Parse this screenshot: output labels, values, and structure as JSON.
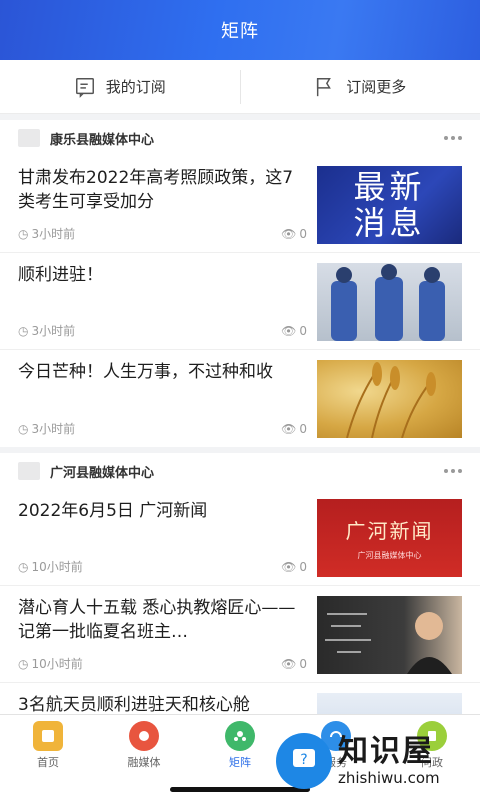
{
  "header": {
    "title": "矩阵"
  },
  "sub_tabs": [
    {
      "label": "我的订阅",
      "icon": "subscription-icon"
    },
    {
      "label": "订阅更多",
      "icon": "subscribe-more-icon"
    }
  ],
  "sections": [
    {
      "name": "康乐县融媒体中心",
      "articles": [
        {
          "title": "甘肃发布2022年高考照顾政策，这7类考生可享受加分",
          "time": "3小时前",
          "views": "0",
          "thumb": "latest-news",
          "thumb_text": [
            "最新",
            "消息"
          ]
        },
        {
          "title": "顺利进驻！",
          "time": "3小时前",
          "views": "0",
          "thumb": "astronauts"
        },
        {
          "title": "今日芒种！人生万事，不过种和收",
          "time": "3小时前",
          "views": "0",
          "thumb": "wheat"
        }
      ]
    },
    {
      "name": "广河县融媒体中心",
      "articles": [
        {
          "title": "2022年6月5日 广河新闻",
          "time": "10小时前",
          "views": "0",
          "thumb": "guanghe-news",
          "thumb_text": [
            "广河新闻",
            "广河县融媒体中心"
          ]
        },
        {
          "title": "潜心育人十五载 悉心执教熔匠心——记第一批临夏名班主…",
          "time": "10小时前",
          "views": "0",
          "thumb": "teacher"
        },
        {
          "title": "3名航天员顺利进驻天和核心舱",
          "time": "",
          "views": "",
          "thumb": "space"
        }
      ]
    }
  ],
  "tabbar": [
    {
      "label": "首页",
      "icon": "home-icon",
      "color": "#f0b43a"
    },
    {
      "label": "融媒体",
      "icon": "media-icon",
      "color": "#e8553f"
    },
    {
      "label": "矩阵",
      "icon": "matrix-icon",
      "color": "#3fb86a"
    },
    {
      "label": "服务",
      "icon": "service-icon",
      "color": "#2d8ee8"
    },
    {
      "label": "问政",
      "icon": "politics-icon",
      "color": "#9bcf3b"
    }
  ],
  "watermark": {
    "main": "知识屋",
    "sub": "zhishiwu.com"
  },
  "colors": {
    "accent": "#2d6fe8",
    "header": "#2f6ff0"
  }
}
